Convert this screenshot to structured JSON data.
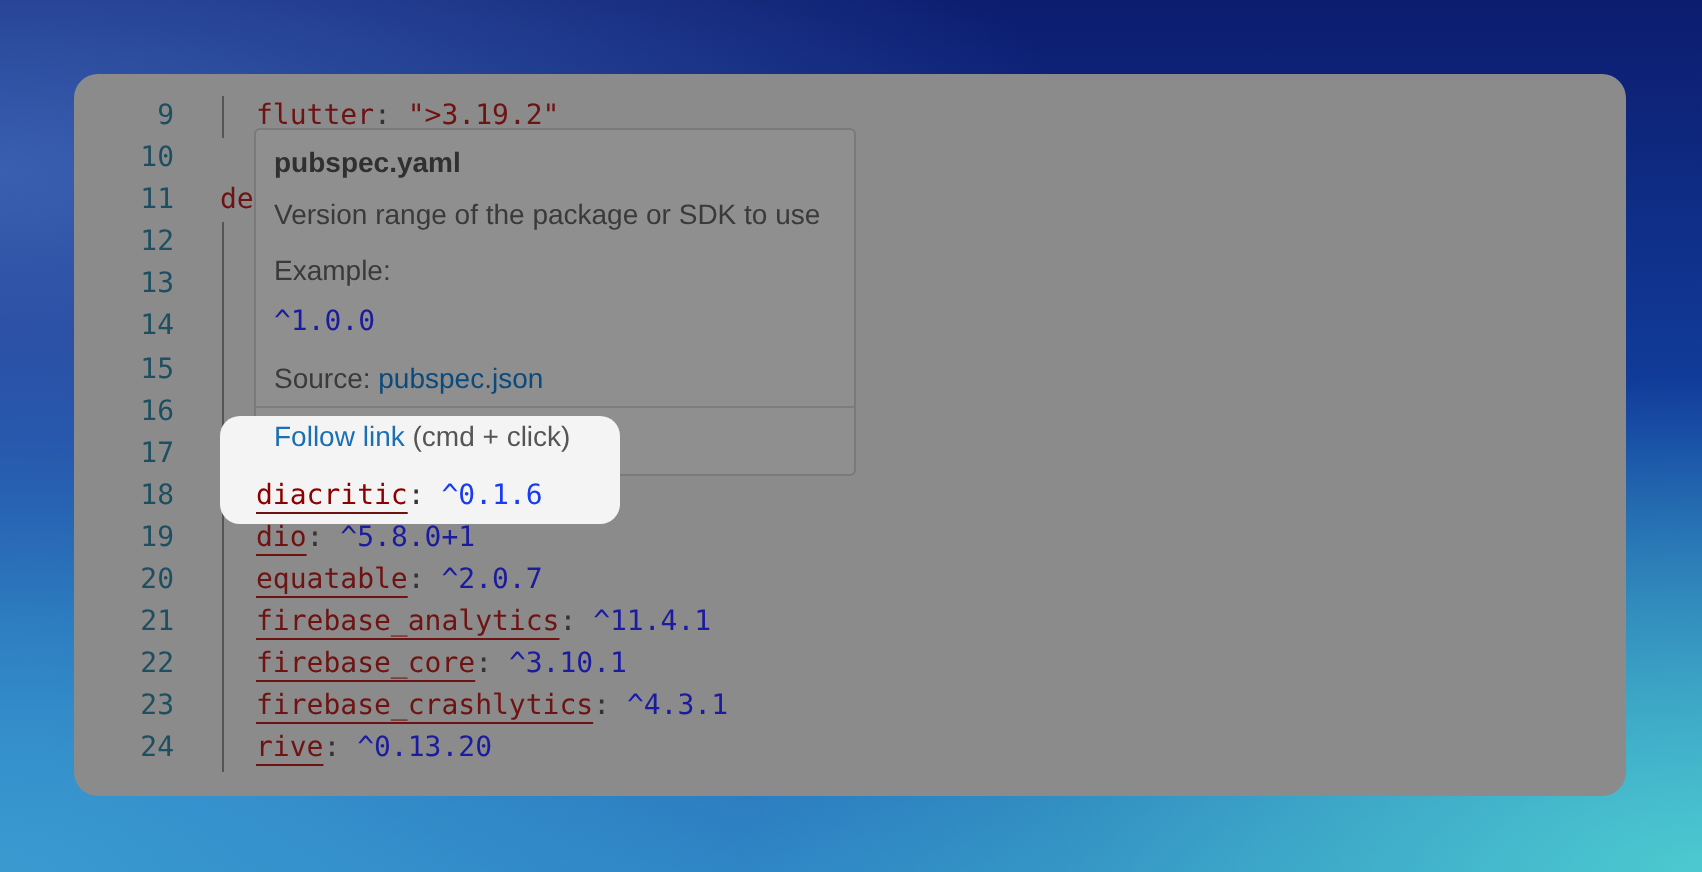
{
  "editor": {
    "lines": [
      {
        "children": [
          {
            "number": "9",
            "key": "flutter",
            "separator": ":",
            "value": "\">3.19.2\"",
            "kind": "string",
            "spotlit": false
          }
        ]
      },
      {
        "number": "10"
      },
      {
        "number": "11",
        "key": "de",
        "underlined": false,
        "spotlit": false,
        "children": [
          {
            "number": "12"
          },
          {
            "number": "13"
          },
          {
            "number": "14"
          },
          {
            "number": "15"
          },
          {
            "number": "16"
          },
          {
            "number": "17"
          },
          {
            "number": "18",
            "key": "diacritic",
            "separator": ":",
            "value": "^0.1.6",
            "kind": "version",
            "underlined": true,
            "spotlit": true
          },
          {
            "number": "19",
            "key": "dio",
            "separator": ":",
            "value": "^5.8.0+1",
            "kind": "version",
            "underlined": true,
            "spotlit": false
          },
          {
            "number": "20",
            "key": "equatable",
            "separator": ":",
            "value": "^2.0.7",
            "kind": "version",
            "underlined": true,
            "spotlit": false
          },
          {
            "number": "21",
            "key": "firebase_analytics",
            "separator": ":",
            "value": "^11.4.1",
            "kind": "version",
            "underlined": true,
            "spotlit": false
          },
          {
            "number": "22",
            "key": "firebase_core",
            "separator": ":",
            "value": "^3.10.1",
            "kind": "version",
            "underlined": true,
            "spotlit": false
          },
          {
            "number": "23",
            "key": "firebase_crashlytics",
            "separator": ":",
            "value": "^4.3.1",
            "kind": "version",
            "underlined": true,
            "spotlit": false
          },
          {
            "number": "24",
            "key": "rive",
            "separator": ":",
            "value": "^0.13.20",
            "kind": "version",
            "underlined": true,
            "spotlit": false
          }
        ]
      }
    ]
  },
  "tooltip": {
    "title": "pubspec.yaml",
    "description": "Version range of the package or SDK to use",
    "example_label": "Example:",
    "example": "^1.0.0",
    "source_label": "Source:",
    "source_link": "pubspec.json",
    "follow_link": "Follow link",
    "follow_hint": "(cmd + click)"
  }
}
